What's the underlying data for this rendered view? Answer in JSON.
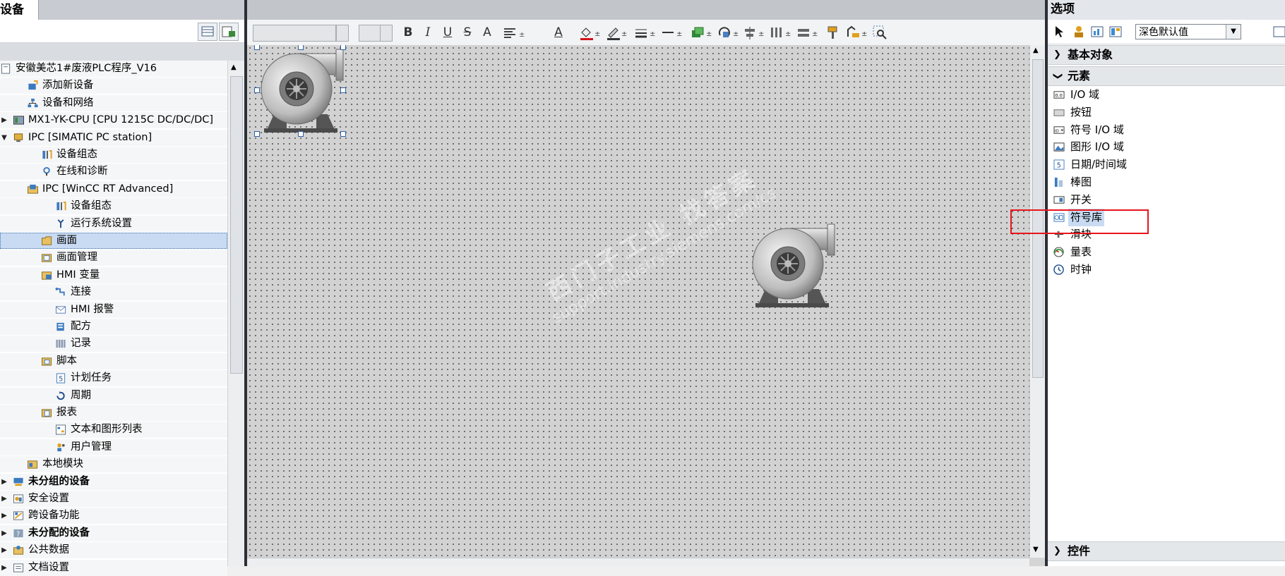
{
  "left_panel": {
    "tab_label": "设备",
    "tree": [
      {
        "label": "安徽美芯1#废液PLC程序_V16",
        "icon": "project-icon",
        "arrow": ""
      },
      {
        "label": "添加新设备",
        "icon": "add-device-icon",
        "arrow": ""
      },
      {
        "label": "设备和网络",
        "icon": "network-icon",
        "arrow": ""
      },
      {
        "label": "MX1-YK-CPU [CPU 1215C DC/DC/DC]",
        "icon": "plc-icon",
        "arrow": "right"
      },
      {
        "label": "IPC [SIMATIC PC station]",
        "icon": "pc-station-icon",
        "arrow": "down"
      },
      {
        "label": "设备组态",
        "icon": "device-config-icon",
        "arrow": ""
      },
      {
        "label": "在线和诊断",
        "icon": "diagnostics-icon",
        "arrow": ""
      },
      {
        "label": "IPC [WinCC RT Advanced]",
        "icon": "hmi-folder-icon",
        "arrow": "down"
      },
      {
        "label": "设备组态",
        "icon": "device-config-icon",
        "arrow": ""
      },
      {
        "label": "运行系统设置",
        "icon": "runtime-settings-icon",
        "arrow": ""
      },
      {
        "label": "画面",
        "icon": "folder-icon",
        "arrow": "right"
      },
      {
        "label": "画面管理",
        "icon": "screen-mgmt-icon",
        "arrow": "right"
      },
      {
        "label": "HMI 变量",
        "icon": "hmi-tags-icon",
        "arrow": "right"
      },
      {
        "label": "连接",
        "icon": "connection-icon",
        "arrow": ""
      },
      {
        "label": "HMI 报警",
        "icon": "alarm-icon",
        "arrow": ""
      },
      {
        "label": "配方",
        "icon": "recipe-icon",
        "arrow": ""
      },
      {
        "label": "记录",
        "icon": "log-icon",
        "arrow": ""
      },
      {
        "label": "脚本",
        "icon": "script-icon",
        "arrow": "right"
      },
      {
        "label": "计划任务",
        "icon": "scheduler-icon",
        "arrow": ""
      },
      {
        "label": "周期",
        "icon": "cycle-icon",
        "arrow": ""
      },
      {
        "label": "报表",
        "icon": "report-icon",
        "arrow": "right"
      },
      {
        "label": "文本和图形列表",
        "icon": "text-graphic-list-icon",
        "arrow": ""
      },
      {
        "label": "用户管理",
        "icon": "user-mgmt-icon",
        "arrow": ""
      },
      {
        "label": "本地模块",
        "icon": "local-module-icon",
        "arrow": "right"
      },
      {
        "label": "未分组的设备",
        "icon": "ungrouped-devices-icon",
        "arrow": "right"
      },
      {
        "label": "安全设置",
        "icon": "security-icon",
        "arrow": "right"
      },
      {
        "label": "跨设备功能",
        "icon": "cross-device-icon",
        "arrow": "right"
      },
      {
        "label": "未分配的设备",
        "icon": "unassigned-devices-icon",
        "arrow": "right"
      },
      {
        "label": "公共数据",
        "icon": "common-data-icon",
        "arrow": "right"
      },
      {
        "label": "文档设置",
        "icon": "doc-settings-icon",
        "arrow": "right"
      }
    ]
  },
  "format_toolbar": {
    "bold": "B",
    "italic": "I",
    "underline": "U",
    "strike": "S",
    "font_size": "A",
    "text_color": "A"
  },
  "canvas": {
    "watermark_line1": "西门子工业 找答案",
    "watermark_line2": "support.industry.siemens.com/cs"
  },
  "right_panel": {
    "title": "选项",
    "style_value": "深色默认值",
    "sections": {
      "basic_objects": "基本对象",
      "elements": "元素",
      "controls": "控件"
    },
    "elements": [
      {
        "label": "I/O 域",
        "icon": "io-field-icon"
      },
      {
        "label": "按钮",
        "icon": "button-icon"
      },
      {
        "label": "符号 I/O 域",
        "icon": "symbolic-io-icon"
      },
      {
        "label": "图形 I/O 域",
        "icon": "graphic-io-icon"
      },
      {
        "label": "日期/时间域",
        "icon": "date-time-icon"
      },
      {
        "label": "棒图",
        "icon": "bar-graph-icon"
      },
      {
        "label": "开关",
        "icon": "switch-icon"
      },
      {
        "label": "符号库",
        "icon": "symbol-library-icon"
      },
      {
        "label": "滑块",
        "icon": "slider-icon"
      },
      {
        "label": "量表",
        "icon": "gauge-icon"
      },
      {
        "label": "时钟",
        "icon": "clock-icon"
      }
    ]
  },
  "colors": {
    "selection": "#c9dbf3",
    "highlight_box": "#e8141c",
    "panel_border": "#2b2f36"
  }
}
